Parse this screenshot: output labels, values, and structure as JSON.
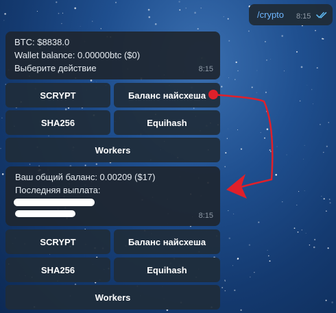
{
  "outgoing": {
    "text": "/crypto",
    "time": "8:15",
    "status_icon": "double-check-icon"
  },
  "message1": {
    "lines": [
      "BTC: $8838.0",
      "Wallet balance: 0.00000btc ($0)",
      "Выберите действие"
    ],
    "time": "8:15"
  },
  "keyboard1": {
    "scrypt": "SCRYPT",
    "balance": "Баланс найсхеша",
    "sha256": "SHA256",
    "equihash": "Equihash",
    "workers": "Workers"
  },
  "message2": {
    "lines": [
      "Ваш общий баланс: 0.00209 ($17)",
      "Последняя выплата:"
    ],
    "time": "8:15"
  },
  "keyboard2": {
    "scrypt": "SCRYPT",
    "balance": "Баланс найсхеша",
    "sha256": "SHA256",
    "equihash": "Equihash",
    "workers": "Workers"
  },
  "colors": {
    "annotation": "#e0202a",
    "link": "#6fb7ff",
    "check": "#5fb8f0"
  }
}
